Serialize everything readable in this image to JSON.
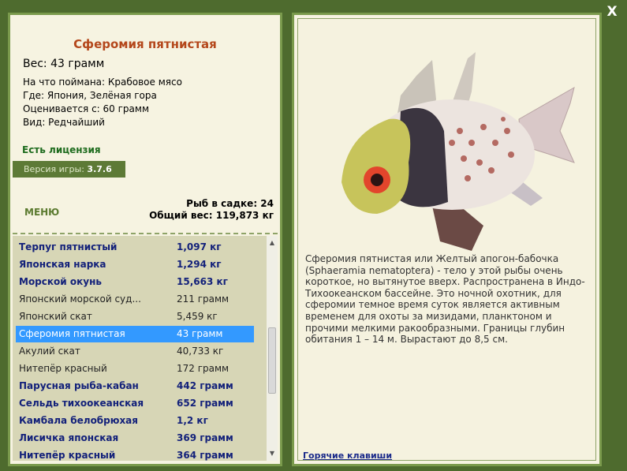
{
  "close_label": "X",
  "fish": {
    "name": "Сферомия пятнистая",
    "weight": "Вес: 43 грамм",
    "caught_with": "На что поймана: Крабовое мясо",
    "location": "Где: Япония, Зелёная гора",
    "valued_from": "Оценивается с: 60 грамм",
    "kind": "Вид: Редчайший"
  },
  "license": "Есть лицензия",
  "version": {
    "label": "Версия игры:",
    "value": "3.7.6"
  },
  "menu_label": "МЕНЮ",
  "stats": {
    "fish_count": "Рыб в садке: 24",
    "total_weight": "Общий вес: 119,873 кг"
  },
  "list": [
    {
      "name": "Терпуг пятнистый",
      "weight": "1,097 кг",
      "style": "caught"
    },
    {
      "name": "Японская нарка",
      "weight": "1,294 кг",
      "style": "caught"
    },
    {
      "name": "Морской окунь",
      "weight": "15,663 кг",
      "style": "caught"
    },
    {
      "name": "Японский морской суд...",
      "weight": "211 грамм",
      "style": "normal"
    },
    {
      "name": "Японский скат",
      "weight": "5,459 кг",
      "style": "normal"
    },
    {
      "name": "Сферомия пятнистая",
      "weight": "43 грамм",
      "style": "selected"
    },
    {
      "name": "Акулий скат",
      "weight": "40,733 кг",
      "style": "normal"
    },
    {
      "name": "Нитепёр красный",
      "weight": "172 грамм",
      "style": "normal"
    },
    {
      "name": "Парусная рыба-кабан",
      "weight": "442 грамм",
      "style": "caught"
    },
    {
      "name": "Сельдь тихоокеанская",
      "weight": "652 грамм",
      "style": "caught"
    },
    {
      "name": "Камбала белобрюхая",
      "weight": "1,2 кг",
      "style": "caught"
    },
    {
      "name": "Лисичка японская",
      "weight": "369 грамм",
      "style": "caught"
    },
    {
      "name": "Нитепёр красный",
      "weight": "364 грамм",
      "style": "caught"
    }
  ],
  "description": "Сферомия пятнистая или Желтый апогон-бабочка (Sphaeramia nematoptera) - тело у этой рыбы очень короткое, но вытянутое вверх. Распространена в Индо-Тихоокеанском бассейне. Это ночной охотник, для сферомии темное время суток является активным временем для охоты за мизидами, планктоном и прочими мелкими ракообразными. Границы глубин обитания 1 – 14 м. Вырастают до 8,5 см.",
  "hotkeys_label": "Горячие клавиши",
  "colors": {
    "background": "#4e6b2e",
    "panel": "#f6f3e1",
    "fish_name": "#b4471b",
    "caught_text": "#13217a",
    "selection": "#3399ff"
  }
}
